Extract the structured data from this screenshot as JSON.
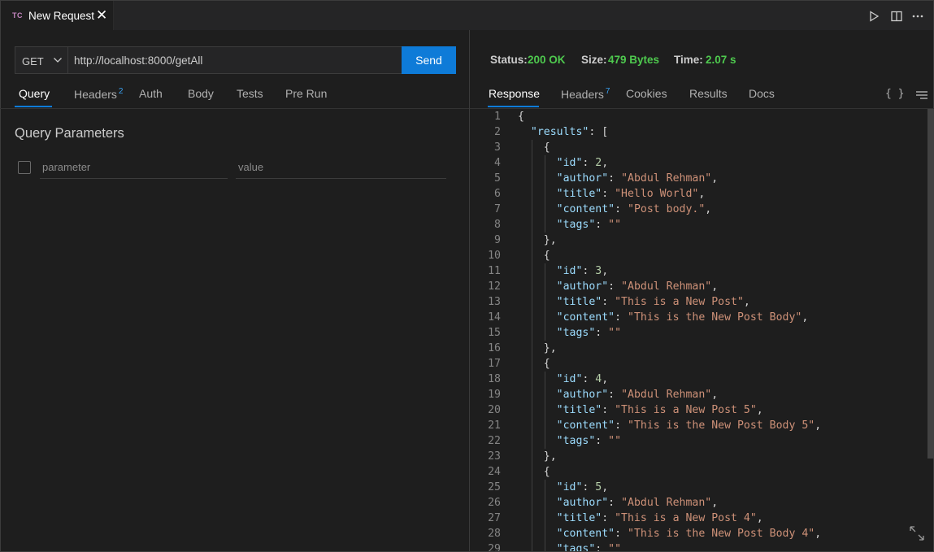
{
  "tab": {
    "icon_text": "TC",
    "title": "New Request"
  },
  "request": {
    "method": "GET",
    "url": "http://localhost:8000/getAll",
    "send_label": "Send"
  },
  "request_tabs": [
    {
      "label": "Query",
      "count": ""
    },
    {
      "label": "Headers",
      "count": "2"
    },
    {
      "label": "Auth",
      "count": ""
    },
    {
      "label": "Body",
      "count": ""
    },
    {
      "label": "Tests",
      "count": ""
    },
    {
      "label": "Pre Run",
      "count": ""
    }
  ],
  "query": {
    "title": "Query Parameters",
    "param_placeholder": "parameter",
    "value_placeholder": "value"
  },
  "status": {
    "status_label": "Status:",
    "status_value": "200 OK",
    "size_label": "Size:",
    "size_value": "479 Bytes",
    "time_label": "Time:",
    "time_value": "2.07 s"
  },
  "response_tabs": [
    {
      "label": "Response",
      "count": ""
    },
    {
      "label": "Headers",
      "count": "7"
    },
    {
      "label": "Cookies",
      "count": ""
    },
    {
      "label": "Results",
      "count": ""
    },
    {
      "label": "Docs",
      "count": ""
    }
  ],
  "format_label": "{ }",
  "code_lines": [
    {
      "n": "1",
      "t": "{"
    },
    {
      "n": "2",
      "t": "  \"results\": ["
    },
    {
      "n": "3",
      "t": "    {"
    },
    {
      "n": "4",
      "t": "      \"id\": 2,"
    },
    {
      "n": "5",
      "t": "      \"author\": \"Abdul Rehman\","
    },
    {
      "n": "6",
      "t": "      \"title\": \"Hello World\","
    },
    {
      "n": "7",
      "t": "      \"content\": \"Post body.\","
    },
    {
      "n": "8",
      "t": "      \"tags\": \"\""
    },
    {
      "n": "9",
      "t": "    },"
    },
    {
      "n": "10",
      "t": "    {"
    },
    {
      "n": "11",
      "t": "      \"id\": 3,"
    },
    {
      "n": "12",
      "t": "      \"author\": \"Abdul Rehman\","
    },
    {
      "n": "13",
      "t": "      \"title\": \"This is a New Post\","
    },
    {
      "n": "14",
      "t": "      \"content\": \"This is the New Post Body\","
    },
    {
      "n": "15",
      "t": "      \"tags\": \"\""
    },
    {
      "n": "16",
      "t": "    },"
    },
    {
      "n": "17",
      "t": "    {"
    },
    {
      "n": "18",
      "t": "      \"id\": 4,"
    },
    {
      "n": "19",
      "t": "      \"author\": \"Abdul Rehman\","
    },
    {
      "n": "20",
      "t": "      \"title\": \"This is a New Post 5\","
    },
    {
      "n": "21",
      "t": "      \"content\": \"This is the New Post Body 5\","
    },
    {
      "n": "22",
      "t": "      \"tags\": \"\""
    },
    {
      "n": "23",
      "t": "    },"
    },
    {
      "n": "24",
      "t": "    {"
    },
    {
      "n": "25",
      "t": "      \"id\": 5,"
    },
    {
      "n": "26",
      "t": "      \"author\": \"Abdul Rehman\","
    },
    {
      "n": "27",
      "t": "      \"title\": \"This is a New Post 4\","
    },
    {
      "n": "28",
      "t": "      \"content\": \"This is the New Post Body 4\","
    },
    {
      "n": "29",
      "t": "      \"tags\": \"\""
    }
  ],
  "colors": {
    "accent": "#0e7bd8",
    "status_ok": "#4ec94e",
    "key": "#9cdcfe",
    "string": "#ce9178",
    "number": "#b5cea8"
  }
}
